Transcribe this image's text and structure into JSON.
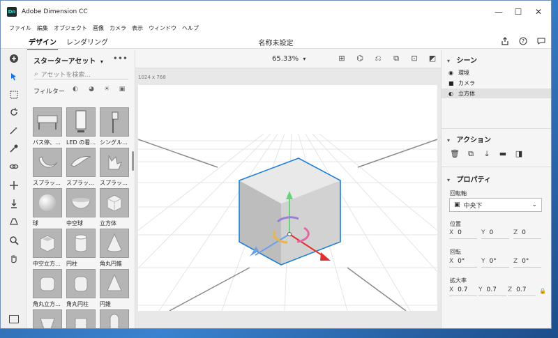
{
  "window": {
    "app_logo": "Dn",
    "title": "Adobe Dimension CC"
  },
  "window_controls": {
    "minimize": "—",
    "maximize": "☐",
    "close": "✕"
  },
  "menu": [
    "ファイル",
    "編集",
    "オブジェクト",
    "画像",
    "カメラ",
    "表示",
    "ウィンドウ",
    "ヘルプ"
  ],
  "tabs": {
    "design": "デザイン",
    "render": "レンダリング"
  },
  "document_title": "名称未設定",
  "assets": {
    "header": "スターターアセット",
    "more": "•••",
    "search_placeholder": "アセットを検索...",
    "filter_label": "フィルター",
    "tiles": [
      {
        "label": "バス停、…",
        "icon": "bus-stop-icon"
      },
      {
        "label": "LED の看…",
        "icon": "led-sign-icon"
      },
      {
        "label": "シングル…",
        "icon": "single-sign-icon"
      },
      {
        "label": "スプラッ…",
        "icon": "splash-icon"
      },
      {
        "label": "スプラッ…",
        "icon": "splash-icon"
      },
      {
        "label": "スプラッ…",
        "icon": "splash-icon"
      },
      {
        "label": "球",
        "icon": "sphere-icon"
      },
      {
        "label": "中空球",
        "icon": "hollow-sphere-icon"
      },
      {
        "label": "立方体",
        "icon": "cube-icon"
      },
      {
        "label": "中空立方…",
        "icon": "hollow-cube-icon"
      },
      {
        "label": "円柱",
        "icon": "cylinder-icon"
      },
      {
        "label": "角丸円錐",
        "icon": "rounded-cone-icon"
      },
      {
        "label": "角丸立方…",
        "icon": "rounded-cube-icon"
      },
      {
        "label": "角丸円柱",
        "icon": "rounded-cylinder-icon"
      },
      {
        "label": "円錐",
        "icon": "cone-icon"
      },
      {
        "label": "",
        "icon": "wedge-icon"
      },
      {
        "label": "",
        "icon": "cylinder-icon"
      },
      {
        "label": "",
        "icon": "capsule-icon"
      }
    ]
  },
  "viewport": {
    "zoom": "65.33%",
    "canvas_size": "1024 x 768"
  },
  "scene": {
    "header": "シーン",
    "items": [
      {
        "label": "環境",
        "icon": "environment-icon"
      },
      {
        "label": "カメラ",
        "icon": "camera-icon"
      },
      {
        "label": "立方体",
        "icon": "cube-icon"
      }
    ]
  },
  "actions": {
    "header": "アクション"
  },
  "properties": {
    "header": "プロパティ",
    "pivot_label": "回転軸",
    "pivot_value": "中央下",
    "position_label": "位置",
    "position": {
      "x": "0",
      "y": "0",
      "z": "0"
    },
    "rotation_label": "回転",
    "rotation": {
      "x": "0°",
      "y": "0°",
      "z": "0°"
    },
    "scale_label": "拡大率",
    "scale": {
      "x": "0.7",
      "y": "0.7",
      "z": "0.7"
    },
    "axis_labels": {
      "x": "X",
      "y": "Y",
      "z": "Z"
    }
  },
  "colors": {
    "accent": "#1473e6",
    "gizmo_red": "#e03030",
    "gizmo_green": "#6ad27a",
    "gizmo_blue": "#6ea0e6"
  }
}
